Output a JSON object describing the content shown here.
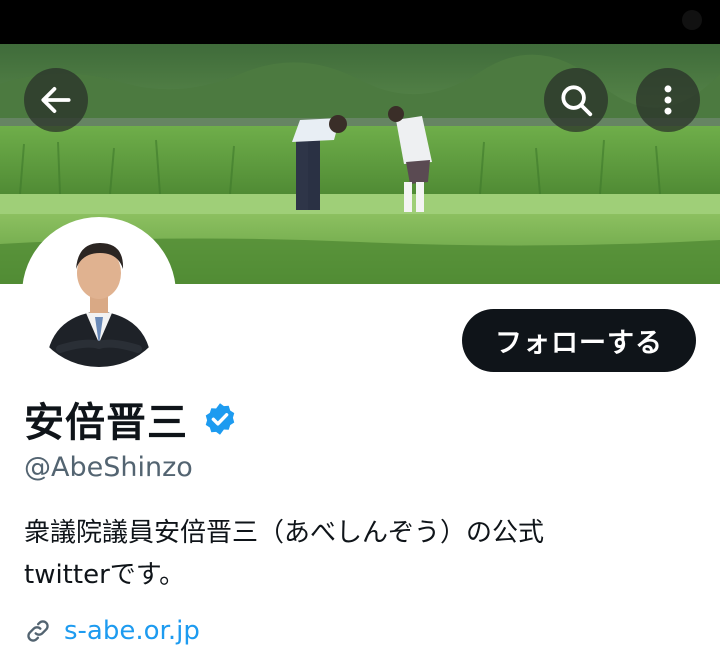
{
  "header": {
    "back_icon": "arrow-left-icon",
    "search_icon": "search-icon",
    "more_icon": "more-vertical-icon"
  },
  "banner": {
    "description_icon": "landscape-photo"
  },
  "profile": {
    "display_name": "安倍晋三",
    "verified": true,
    "verified_color": "#1d9bf0",
    "handle": "@AbeShinzo",
    "bio_line1": "衆議院議員安倍晋三（あべしんぞう）の公式",
    "bio_line2": "twitterです。",
    "website": "s-abe.or.jp",
    "follow_label": "フォローする"
  },
  "colors": {
    "link": "#1d9bf0",
    "follow_bg": "#0f1419",
    "secondary_text": "#536471"
  }
}
